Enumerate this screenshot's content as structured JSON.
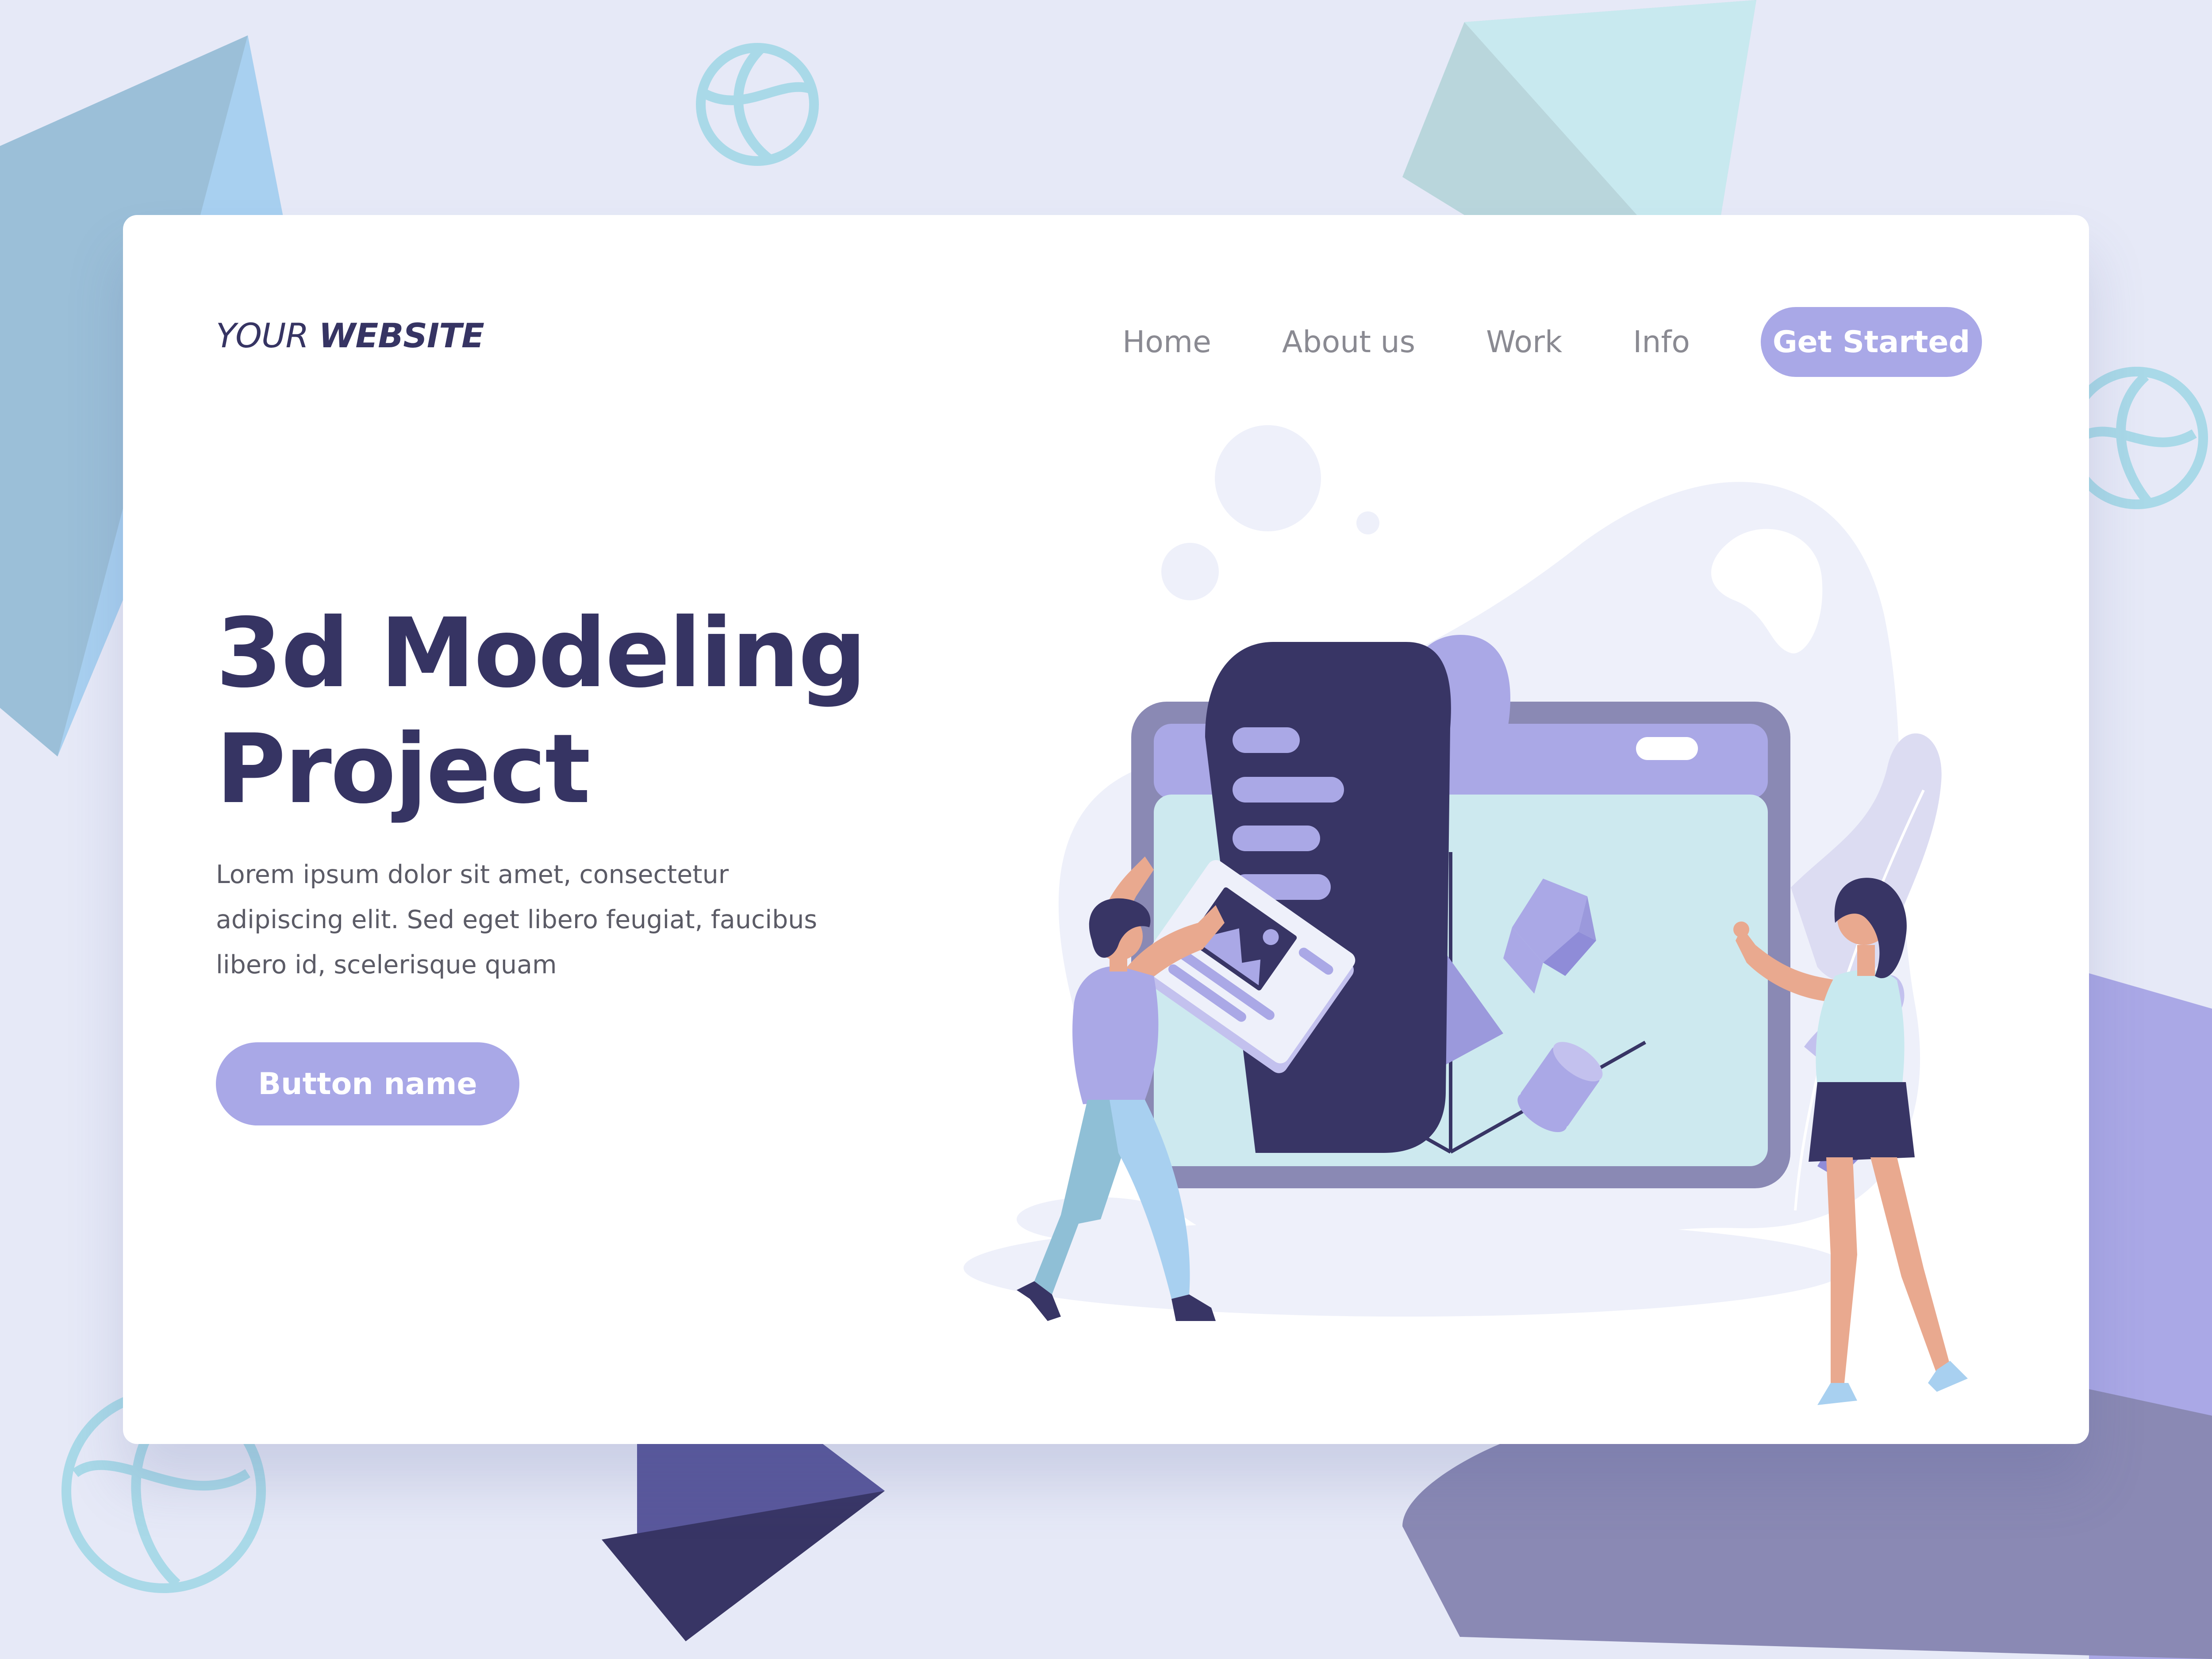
{
  "header": {
    "logo_light": "YOUR",
    "logo_bold": "WEBSITE"
  },
  "nav": {
    "items": [
      {
        "label": "Home"
      },
      {
        "label": "About us"
      },
      {
        "label": "Work"
      },
      {
        "label": "Info"
      }
    ],
    "cta_label": "Get Started"
  },
  "hero": {
    "title_line1": "3d Modeling",
    "title_line2": "Project",
    "description": "Lorem ipsum dolor sit amet, consectetur adipiscing elit. Sed eget libero feugiat, faucibus libero id, scelerisque quam",
    "button_label": "Button name"
  },
  "colors": {
    "page_background": "#e6e9f7",
    "card_background": "#ffffff",
    "heading": "#363463",
    "accent": "#a9a8e7",
    "nav_text": "#8a8a92",
    "body_text": "#5b5b66",
    "screen_fill": "#cde9ef",
    "dark_scroll": "#383565"
  },
  "illustration": {
    "subject": "two people assembling a 3d model on a large browser window",
    "icons": [
      "globe-icon",
      "image-icon",
      "pyramid-shape",
      "cube-shape",
      "cylinder-shape"
    ]
  }
}
